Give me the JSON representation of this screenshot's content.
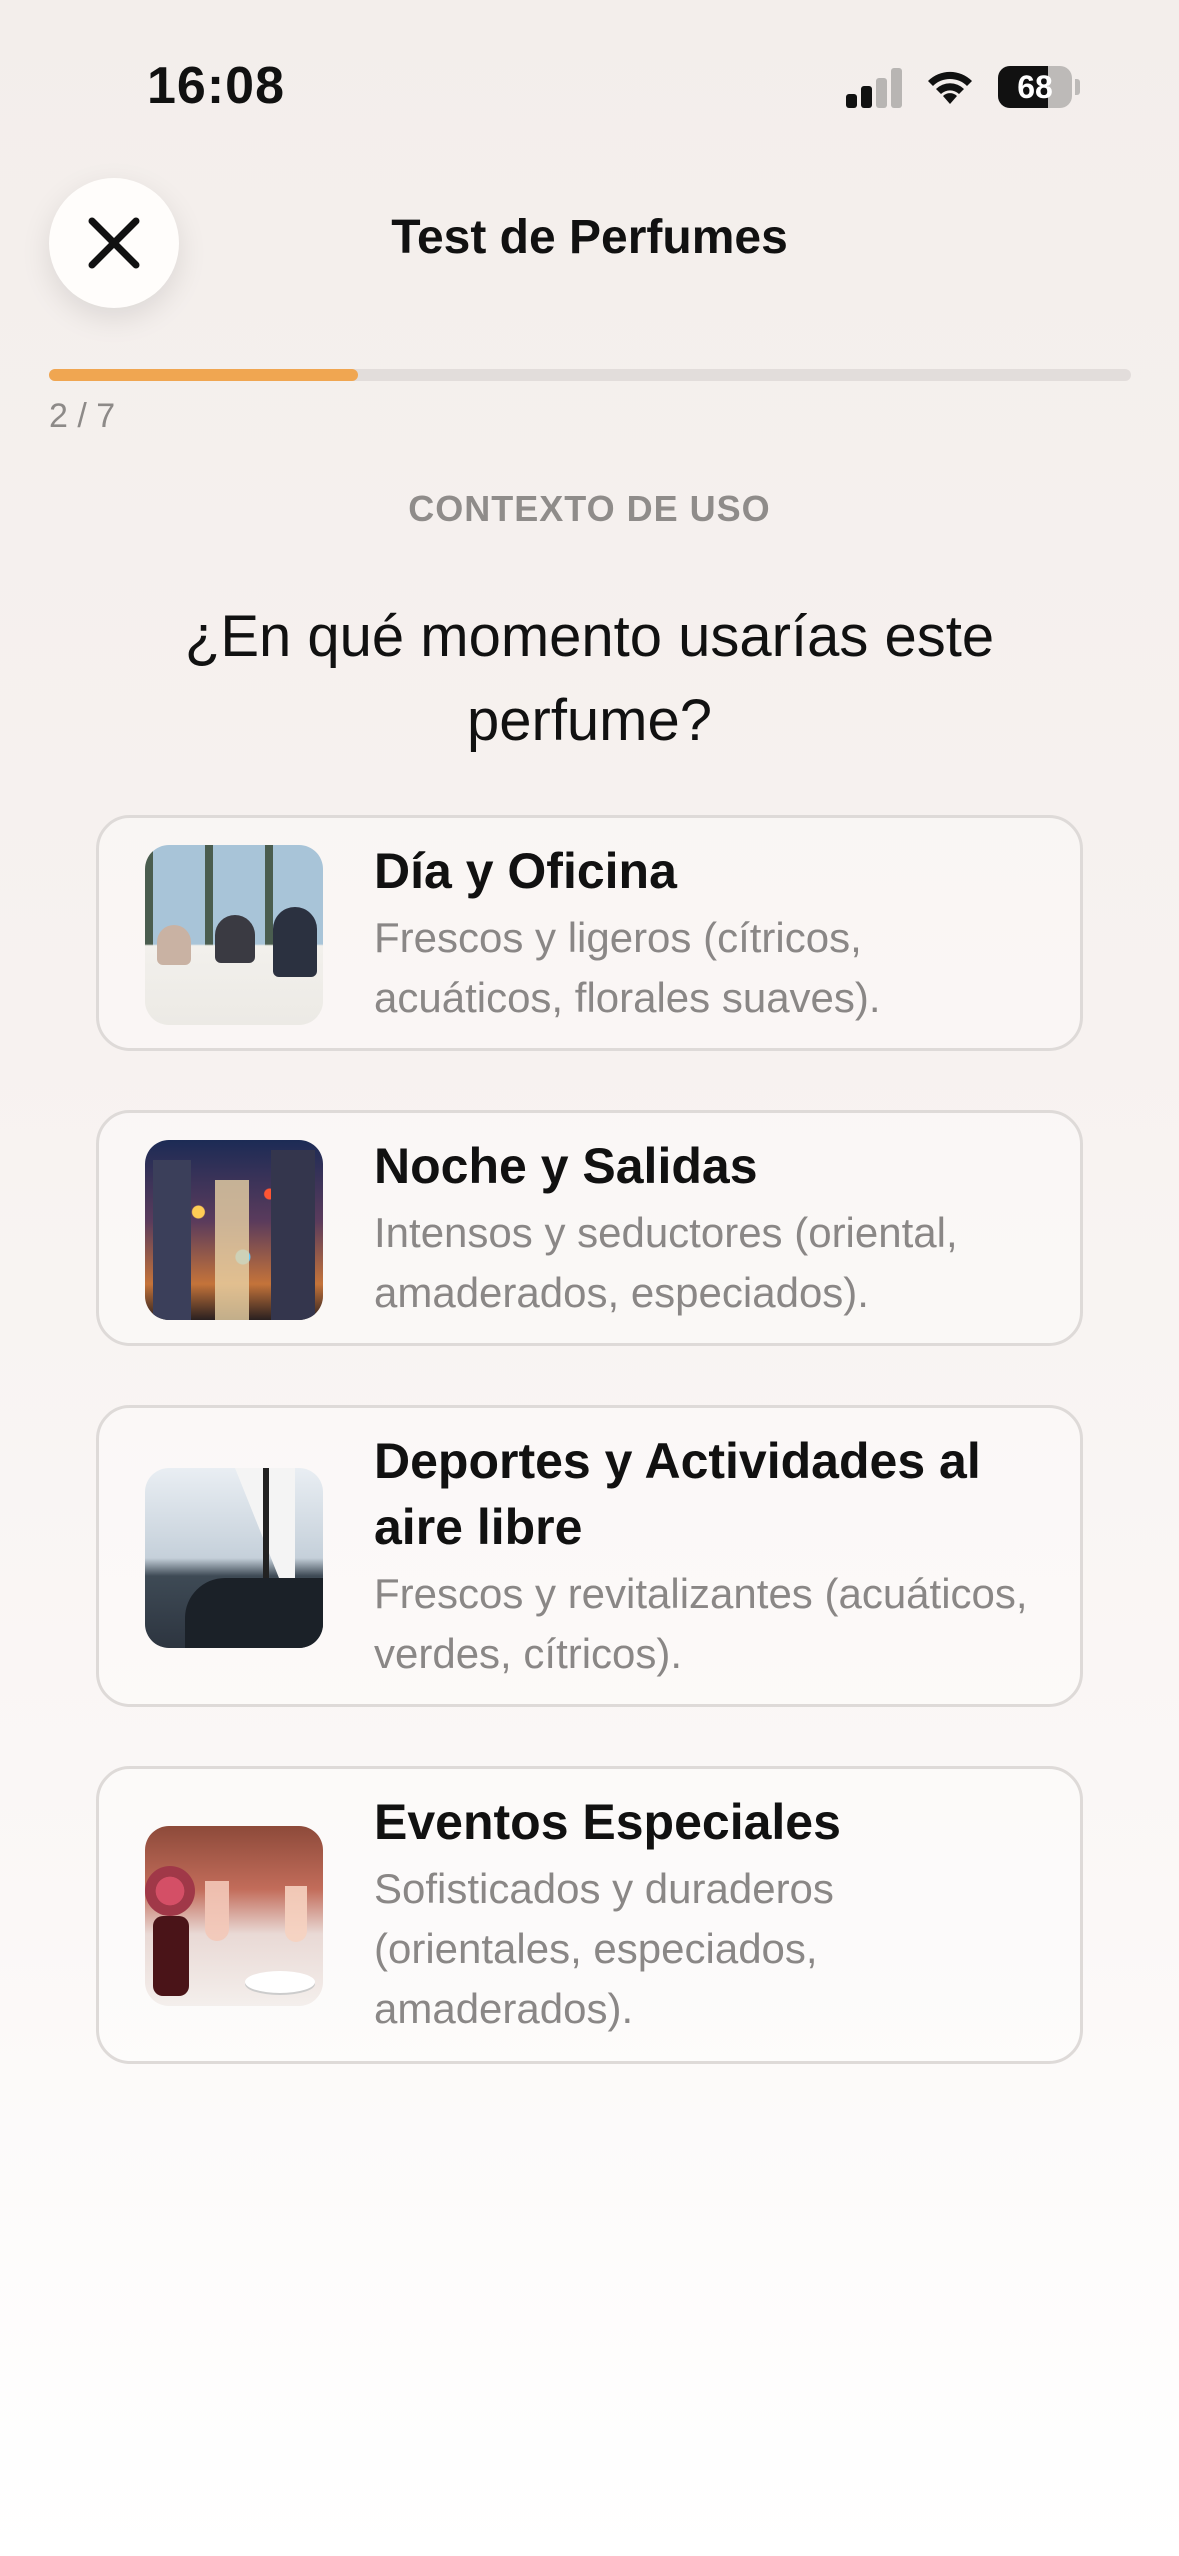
{
  "status_bar": {
    "time": "16:08",
    "battery_level": "68",
    "icons": [
      "cellular-signal-icon",
      "wifi-icon",
      "battery-icon"
    ]
  },
  "header": {
    "title": "Test de Perfumes",
    "close_icon": "close-icon"
  },
  "progress": {
    "label": "2 / 7",
    "current": 2,
    "total": 7,
    "fill_color": "#f0a651"
  },
  "section_label": "CONTEXTO DE USO",
  "question": "¿En qué momento usarías este perfume?",
  "options": [
    {
      "title": "Día y Oficina",
      "description": "Frescos y ligeros (cítricos, acuáticos, florales suaves).",
      "image": "office-meeting-photo"
    },
    {
      "title": "Noche y Salidas",
      "description": "Intensos y seductores (oriental, amaderados, especiados).",
      "image": "city-night-photo"
    },
    {
      "title": "Deportes y Actividades al aire libre",
      "description": "Frescos y revitalizantes (acuáticos, verdes, cítricos).",
      "image": "sailboat-photo"
    },
    {
      "title": "Eventos Especiales",
      "description": "Sofisticados y duraderos (orientales, especiados, amaderados).",
      "image": "elegant-dinner-photo"
    }
  ]
}
